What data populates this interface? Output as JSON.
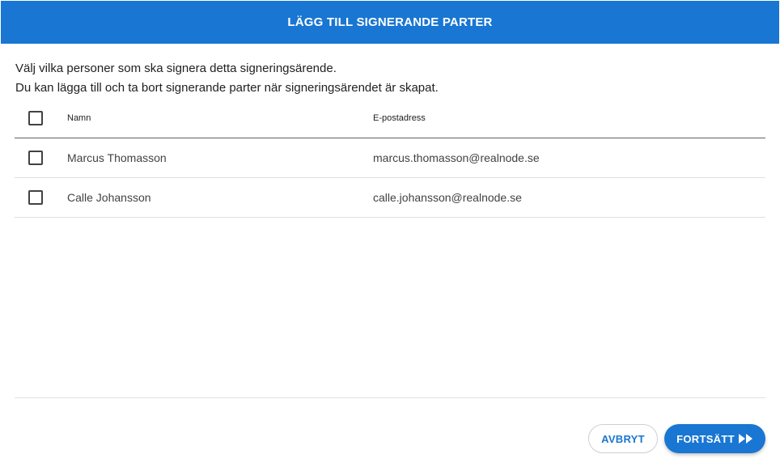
{
  "dialog": {
    "title": "LÄGG TILL SIGNERANDE PARTER",
    "intro_line1": "Välj vilka personer som ska signera detta signeringsärende.",
    "intro_line2": "Du kan lägga till och ta bort signerande parter när signeringsärendet är skapat."
  },
  "table": {
    "columns": {
      "name": "Namn",
      "email": "E-postadress"
    },
    "rows": [
      {
        "name": "Marcus Thomasson",
        "email": "marcus.thomasson@realnode.se",
        "checked": false
      },
      {
        "name": "Calle Johansson",
        "email": "calle.johansson@realnode.se",
        "checked": false
      }
    ]
  },
  "actions": {
    "cancel_label": "AVBRYT",
    "continue_label": "FORTSÄTT",
    "continue_icon": "fast-forward-icon"
  },
  "colors": {
    "primary": "#1976d2"
  }
}
